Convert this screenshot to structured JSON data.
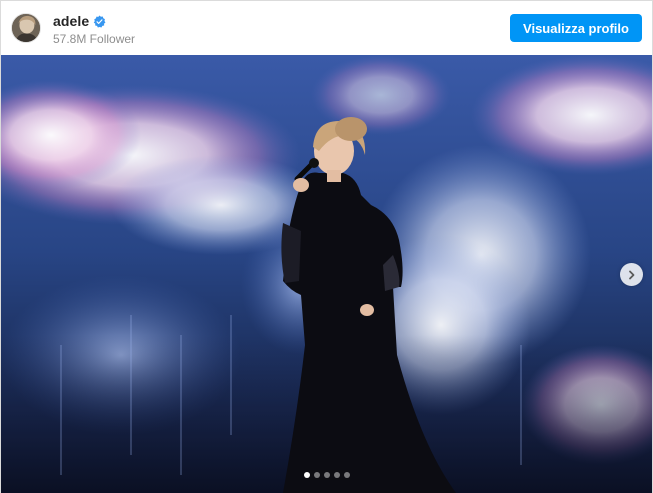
{
  "post": {
    "username": "adele",
    "verified": true,
    "followers": "57.8M Follower",
    "profile_button": "Visualizza profilo",
    "carousel": {
      "total": 5,
      "active_index": 0,
      "next_icon": "chevron-right-icon"
    }
  },
  "colors": {
    "button_blue": "#0095f6",
    "verified_blue": "#3897f0"
  }
}
